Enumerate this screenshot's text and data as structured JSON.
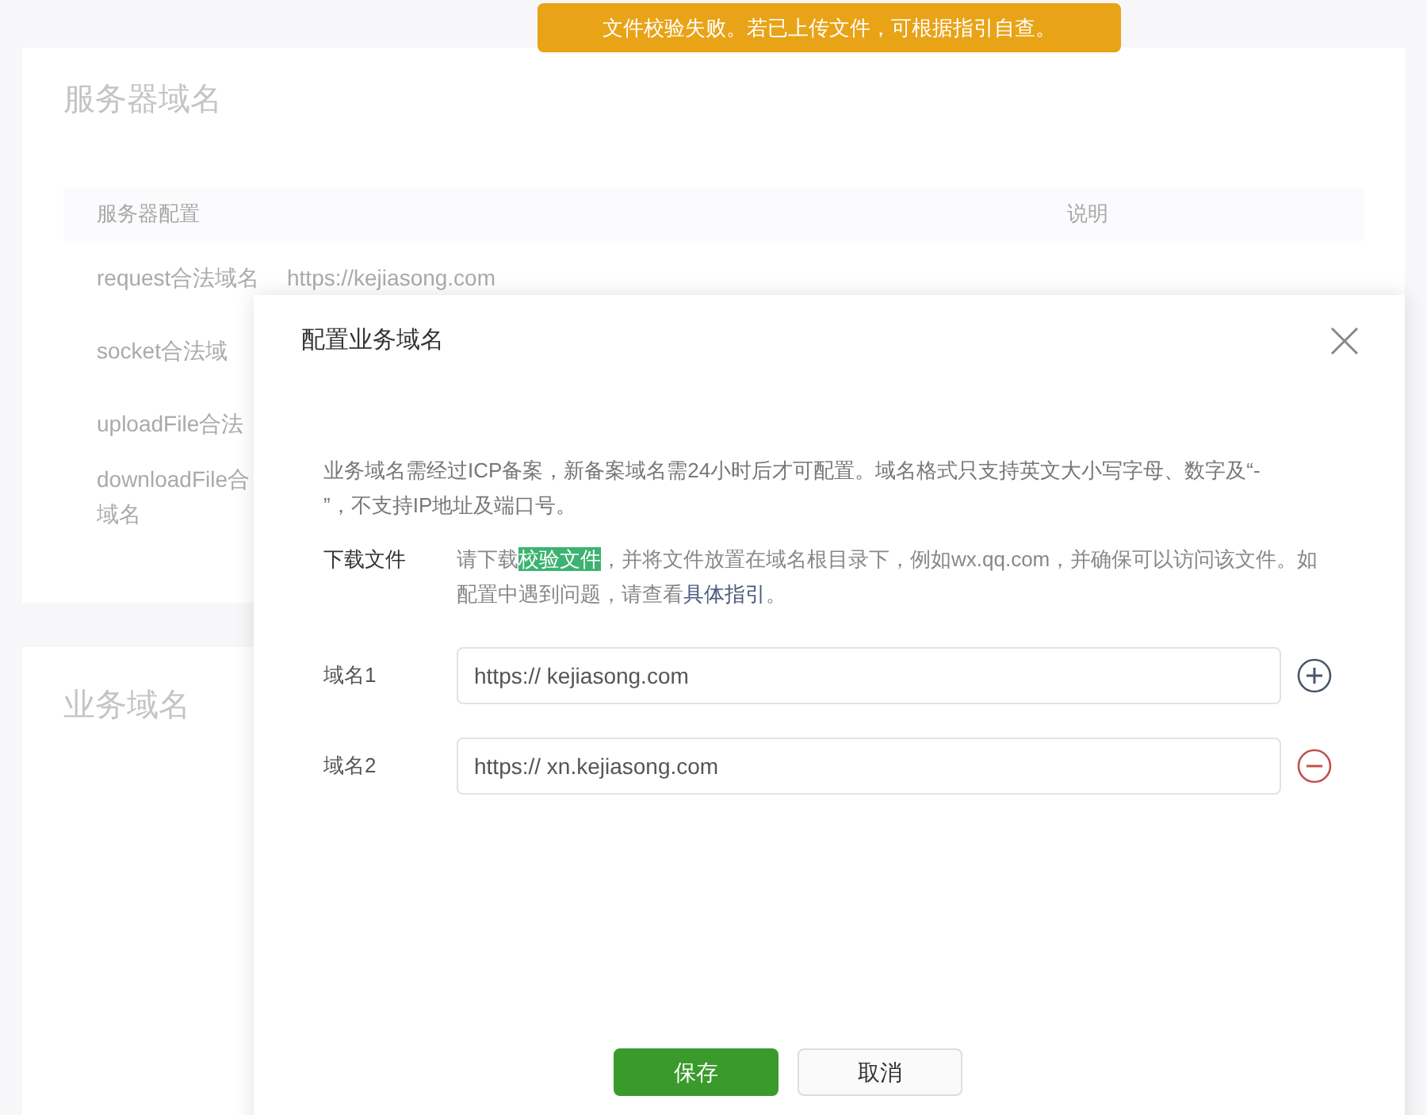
{
  "toast": {
    "text": "文件校验失败。若已上传文件，可根据指引自查。"
  },
  "server_domains": {
    "title": "服务器域名",
    "columns": [
      "服务器配置",
      "说明"
    ],
    "rows": [
      {
        "label": "request合法域名",
        "value": "https://kejiasong.com"
      },
      {
        "label": "socket合法域"
      },
      {
        "label": "uploadFile合法"
      },
      {
        "label": "downloadFile合",
        "label_line_2": "域名"
      }
    ]
  },
  "business_domains": {
    "title": "业务域名"
  },
  "dialog": {
    "title": "配置业务域名",
    "notice": "业务域名需经过ICP备案，新备案域名需24小时后才可配置。域名格式只支持英文大小写字母、数字及“- ”，不支持IP地址及端口号。",
    "download": {
      "label": "下载文件",
      "text_before": "请下载",
      "link": "校验文件",
      "text_middle": "，并将文件放置在域名根目录下，例如wx.qq.com，并确保可以访问该文件。如配置中遇到问题，请查看",
      "guide_link": "具体指引",
      "text_after": "。"
    },
    "domains": [
      {
        "label": "域名1",
        "value": "https:// kejiasong.com",
        "kind": "add"
      },
      {
        "label": "域名2",
        "value": "https:// xn.kejiasong.com",
        "kind": "remove"
      }
    ],
    "buttons": [
      {
        "label": "保存",
        "kind": "primary"
      },
      {
        "label": "取消",
        "kind": "secondary"
      }
    ]
  }
}
